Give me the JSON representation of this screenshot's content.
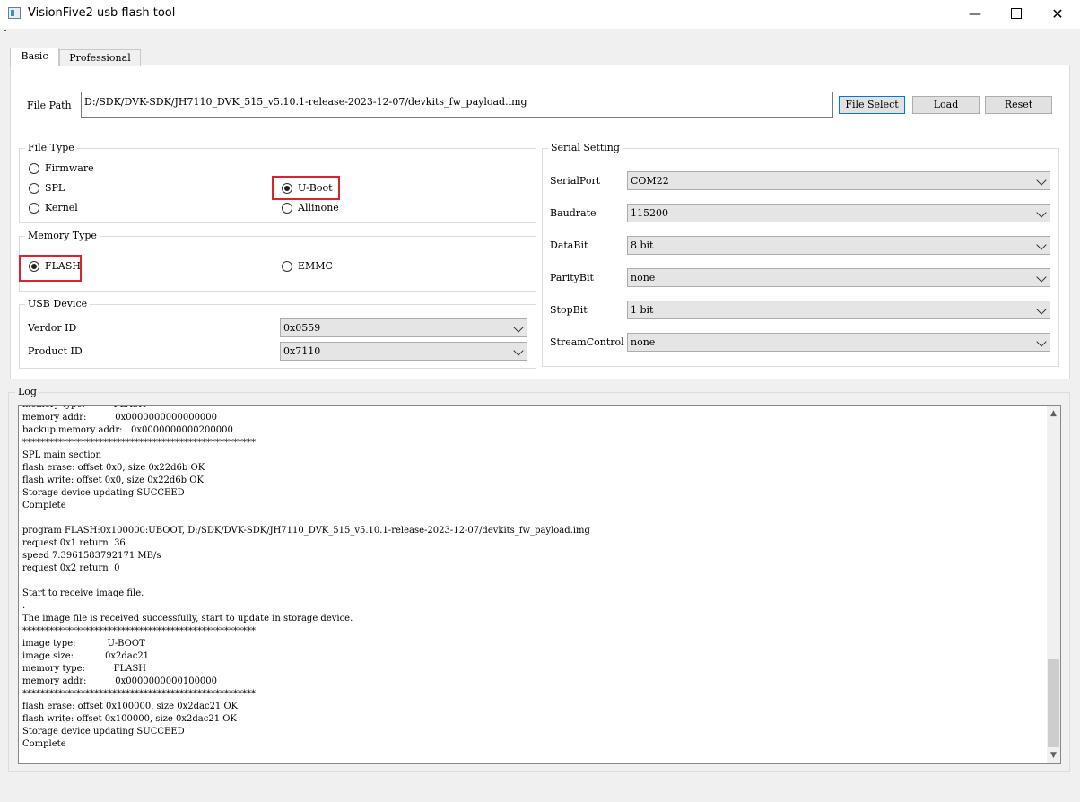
{
  "window": {
    "title": "VisionFive2 usb flash tool",
    "minimize_glyph": "—",
    "close_glyph": "✕"
  },
  "tabs": [
    {
      "label": "Basic",
      "selected": true
    },
    {
      "label": "Professional",
      "selected": false
    }
  ],
  "file_path": {
    "label": "File Path",
    "value": "D:/SDK/DVK-SDK/JH7110_DVK_515_v5.10.1-release-2023-12-07/devkits_fw_payload.img",
    "buttons": {
      "file_select": "File Select",
      "load": "Load",
      "reset": "Reset"
    }
  },
  "file_type": {
    "title": "File Type",
    "options": [
      {
        "label": "Firmware",
        "checked": false
      },
      {
        "label": "SPL",
        "checked": false
      },
      {
        "label": "Kernel",
        "checked": false
      },
      {
        "label": "U-Boot",
        "checked": true
      },
      {
        "label": "Allinone",
        "checked": false
      }
    ]
  },
  "memory_type": {
    "title": "Memory Type",
    "options": [
      {
        "label": "FLASH",
        "checked": true
      },
      {
        "label": "EMMC",
        "checked": false
      }
    ]
  },
  "usb_device": {
    "title": "USB Device",
    "vendor_id_label": "Verdor ID",
    "vendor_id": "0x0559",
    "product_id_label": "Product ID",
    "product_id": "0x7110"
  },
  "serial_setting": {
    "title": "Serial Setting",
    "fields": [
      {
        "label": "SerialPort",
        "value": "COM22"
      },
      {
        "label": "Baudrate",
        "value": "115200"
      },
      {
        "label": "DataBit",
        "value": "8 bit"
      },
      {
        "label": "ParityBit",
        "value": "none"
      },
      {
        "label": "StopBit",
        "value": "1 bit"
      },
      {
        "label": "StreamControl",
        "value": "none"
      }
    ]
  },
  "log": {
    "title": "Log",
    "text": "memory type:          FLASH\nmemory addr:          0x0000000000000000\nbackup memory addr:   0x0000000000200000\n****************************************************\nSPL main section\nflash erase: offset 0x0, size 0x22d6b OK\nflash write: offset 0x0, size 0x22d6b OK\nStorage device updating SUCCEED\nComplete\n\nprogram FLASH:0x100000:UBOOT, D:/SDK/DVK-SDK/JH7110_DVK_515_v5.10.1-release-2023-12-07/devkits_fw_payload.img\nrequest 0x1 return  36\nspeed 7.3961583792171 MB/s\nrequest 0x2 return  0\n\nStart to receive image file.\n.\nThe image file is received successfully, start to update in storage device.\n****************************************************\nimage type:           U-BOOT\nimage size:           0x2dac21\nmemory type:          FLASH\nmemory addr:          0x0000000000100000\n****************************************************\nflash erase: offset 0x100000, size 0x2dac21 OK\nflash write: offset 0x100000, size 0x2dac21 OK\nStorage device updating SUCCEED\nComplete",
    "scroll_up_glyph": "▲",
    "scroll_down_glyph": "▼"
  },
  "colors": {
    "highlight": "#d9232e",
    "focus_border": "#0078d7",
    "window_background": "#f0f0f0"
  }
}
